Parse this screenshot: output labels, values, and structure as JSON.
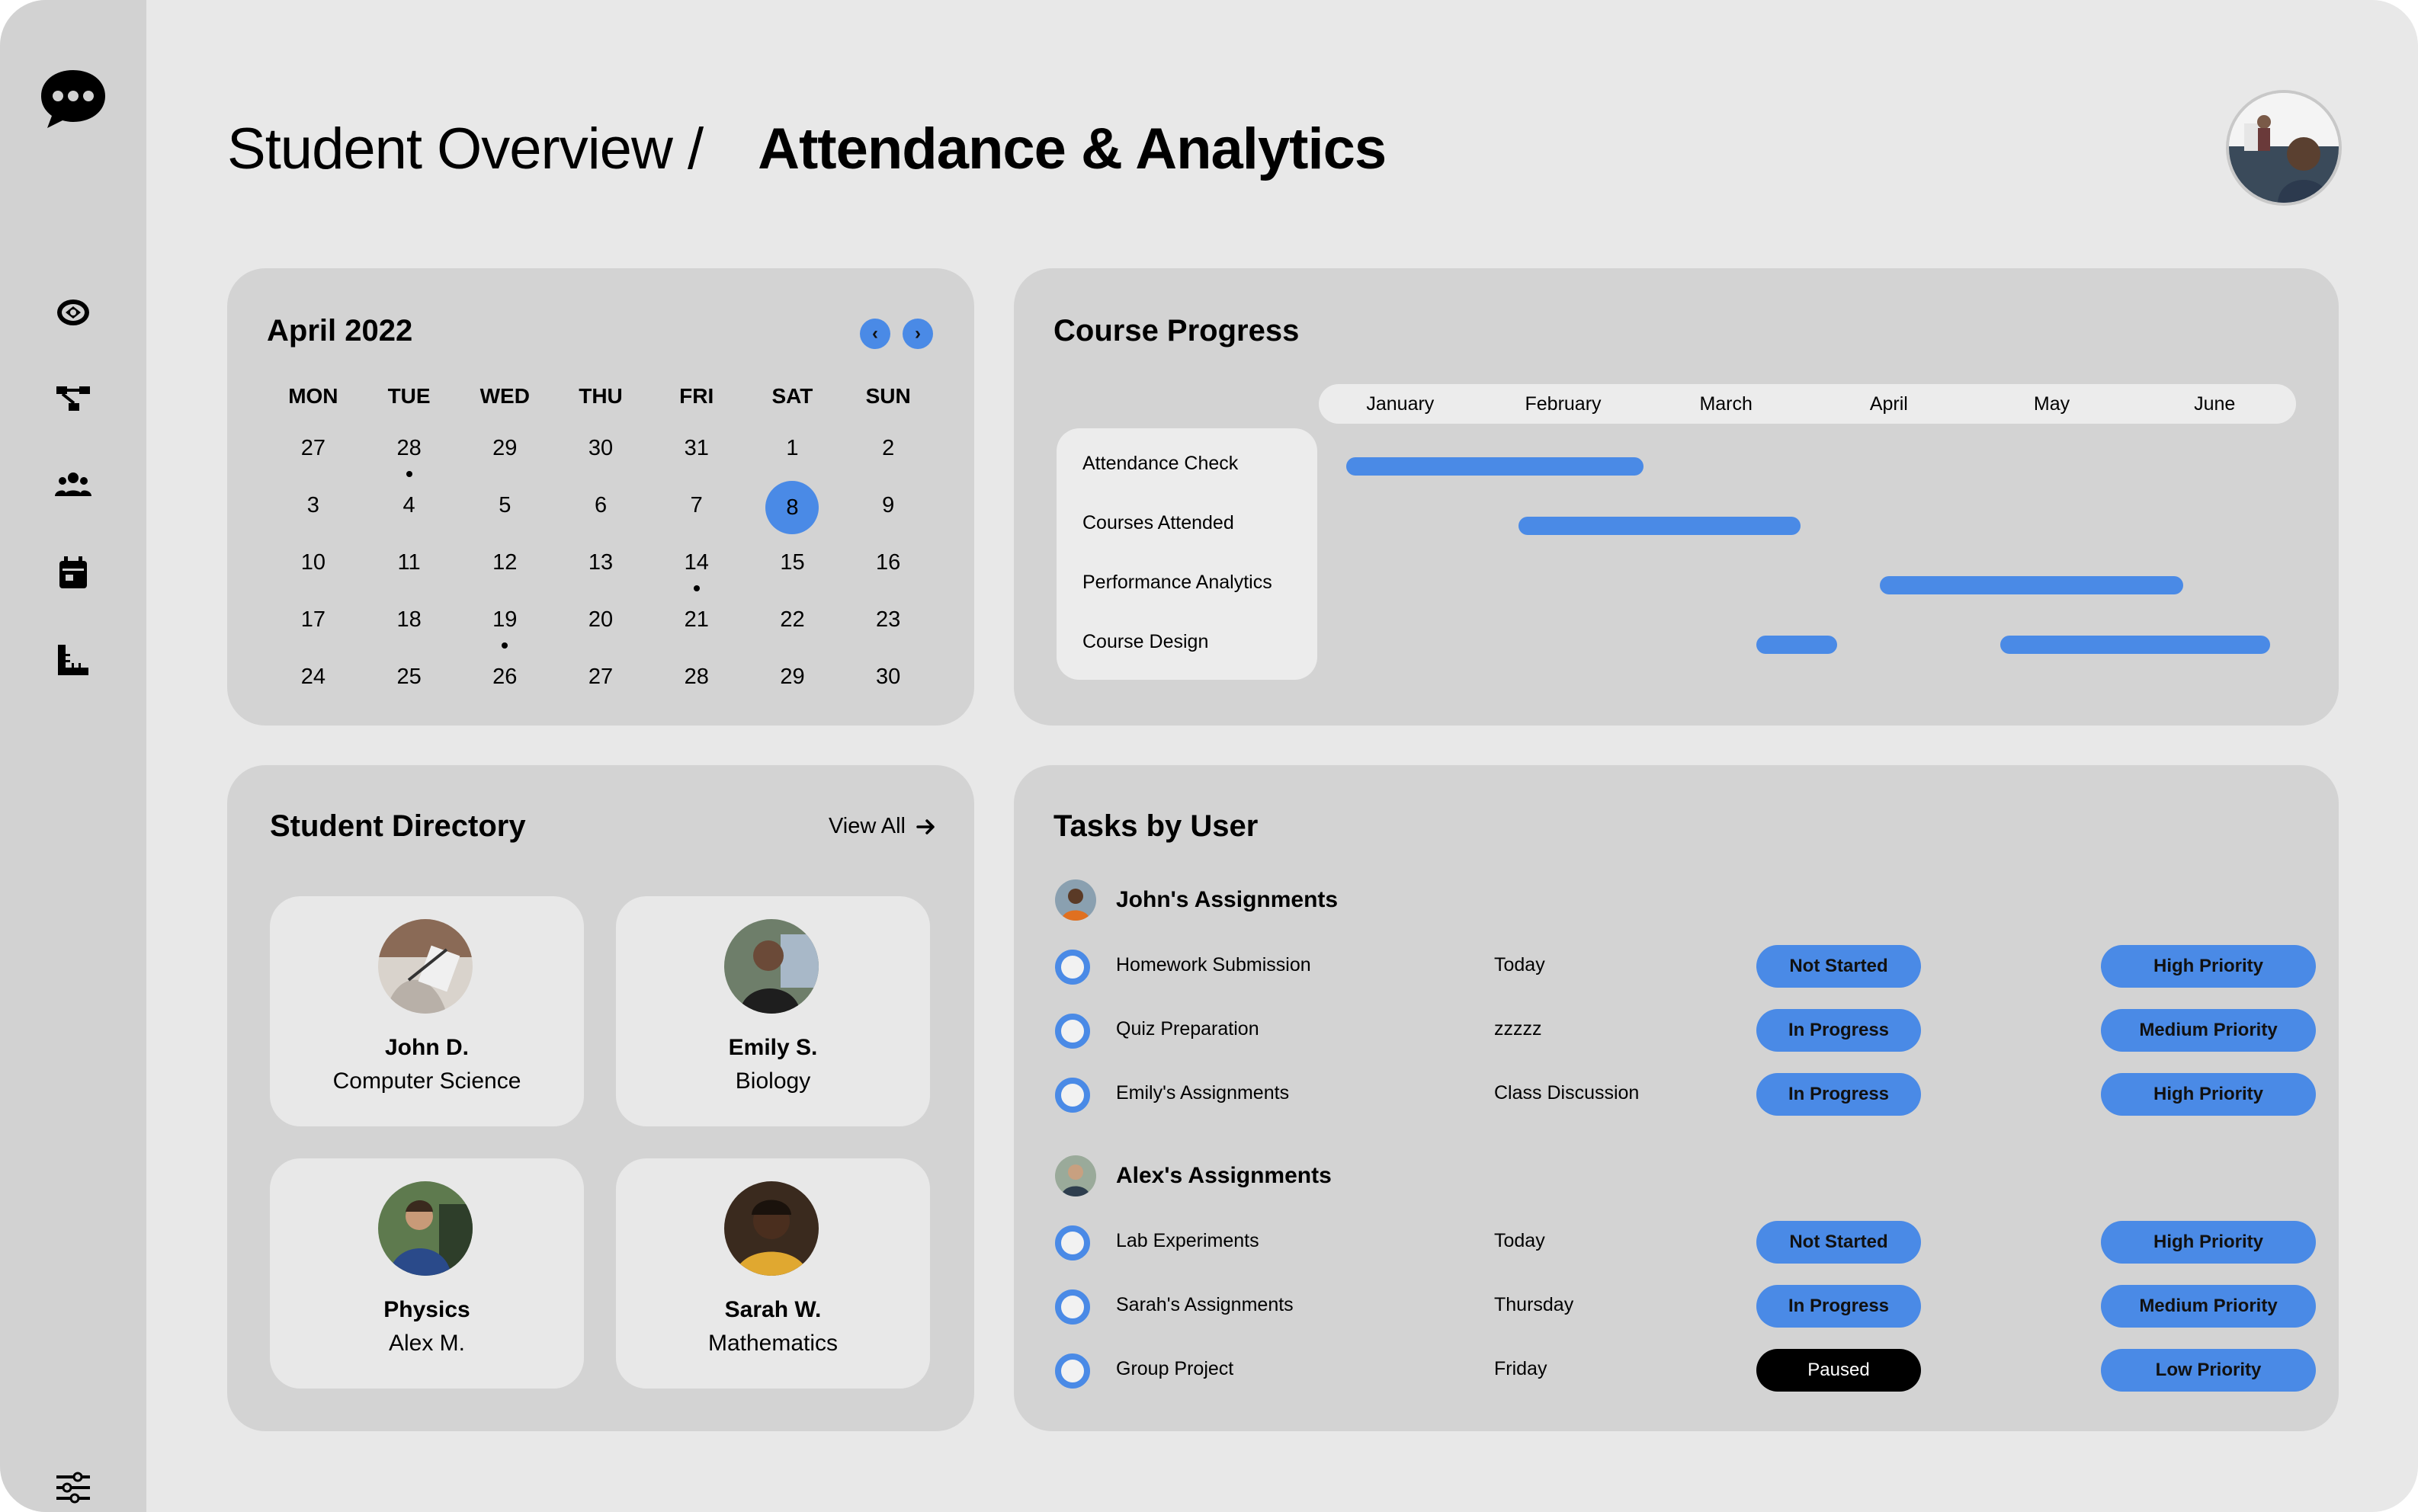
{
  "header": {
    "parent": "Student Overview /",
    "current": "Attendance & Analytics"
  },
  "sidebar": {
    "items": [
      {
        "icon": "chat-bubble-icon"
      },
      {
        "icon": "dashboard-icon"
      },
      {
        "icon": "workflow-icon"
      },
      {
        "icon": "users-icon"
      },
      {
        "icon": "calendar-icon"
      },
      {
        "icon": "ruler-icon"
      },
      {
        "icon": "sliders-icon"
      }
    ]
  },
  "calendar": {
    "title": "April 2022",
    "prev_icon": "‹",
    "next_icon": "›",
    "weekdays": [
      "MON",
      "TUE",
      "WED",
      "THU",
      "FRI",
      "SAT",
      "SUN"
    ],
    "weeks": [
      [
        "27",
        "28",
        "29",
        "30",
        "31",
        "1",
        "2"
      ],
      [
        "3",
        "4",
        "5",
        "6",
        "7",
        "8",
        "9"
      ],
      [
        "10",
        "11",
        "12",
        "13",
        "14",
        "15",
        "16"
      ],
      [
        "17",
        "18",
        "19",
        "20",
        "21",
        "22",
        "23"
      ],
      [
        "24",
        "25",
        "26",
        "27",
        "28",
        "29",
        "30"
      ]
    ],
    "selected": "8",
    "event_days": [
      "0-1",
      "2-4",
      "3-2"
    ]
  },
  "course_progress": {
    "title": "Course Progress",
    "months": [
      "January",
      "February",
      "March",
      "April",
      "May",
      "June"
    ],
    "rows": [
      {
        "label": "Attendance Check"
      },
      {
        "label": "Courses Attended"
      },
      {
        "label": "Performance Analytics"
      },
      {
        "label": "Course Design"
      }
    ],
    "accent": "#4a8ae6"
  },
  "directory": {
    "title": "Student Directory",
    "view_all": "View All",
    "students": [
      {
        "line1": "John D.",
        "line2": "Computer Science"
      },
      {
        "line1": "Emily S.",
        "line2": "Biology"
      },
      {
        "line1": "Physics",
        "line2": "Alex M."
      },
      {
        "line1": "Sarah W.",
        "line2": "Mathematics"
      }
    ]
  },
  "tasks": {
    "title": "Tasks by User",
    "groups": [
      {
        "name": "John's Assignments",
        "items": [
          {
            "name": "Homework Submission",
            "due": "Today",
            "status": "Not Started",
            "priority": "High Priority"
          },
          {
            "name": "Quiz Preparation",
            "due": "zzzzz",
            "status": "In Progress",
            "priority": "Medium Priority"
          },
          {
            "name": "Emily's Assignments",
            "due": "Class Discussion",
            "status": "In Progress",
            "priority": "High Priority"
          }
        ]
      },
      {
        "name": "Alex's Assignments",
        "items": [
          {
            "name": "Lab Experiments",
            "due": "Today",
            "status": "Not Started",
            "priority": "High Priority"
          },
          {
            "name": "Sarah's Assignments",
            "due": "Thursday",
            "status": "In Progress",
            "priority": "Medium Priority"
          },
          {
            "name": "Group Project",
            "due": "Friday",
            "status": "Paused",
            "priority": "Low Priority"
          }
        ]
      }
    ]
  },
  "colors": {
    "background": "#e8e8e8",
    "sidebar": "#d2d2d2",
    "card": "#d3d3d3",
    "accent": "#4a8ae6",
    "paused": "#000000"
  }
}
